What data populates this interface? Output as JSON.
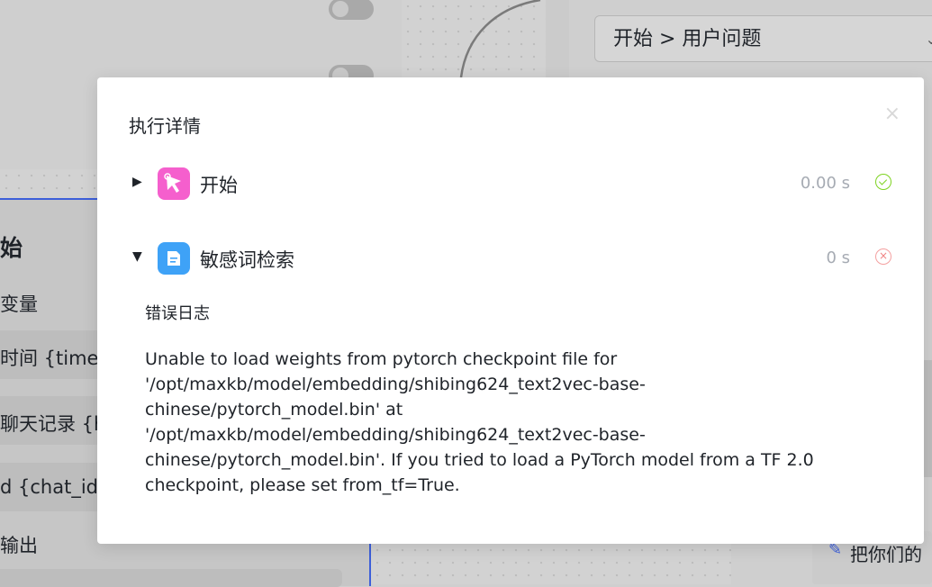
{
  "background": {
    "breadcrumb_select": {
      "value": "开始 > 用户问题"
    },
    "start_node": {
      "title": "始",
      "section_label": "变量",
      "fields": [
        "时间 {time}",
        "聊天记录 {h",
        "d {chat_id}"
      ],
      "output_label": "输出"
    },
    "right_card_text": "把你们的"
  },
  "modal": {
    "title": "执行详情",
    "close_symbol": "×",
    "steps": [
      {
        "name": "开始",
        "time": "0.00 s",
        "status": "success",
        "expanded": false,
        "icon": "cursor-icon",
        "icon_color": "#f55fcd"
      },
      {
        "name": "敏感词检索",
        "time": "0 s",
        "status": "error",
        "expanded": true,
        "icon": "document-icon",
        "icon_color": "#3ea2f7"
      }
    ],
    "error_log": {
      "label": "错误日志",
      "message": "Unable to load weights from pytorch checkpoint file for\n'/opt/maxkb/model/embedding/shibing624_text2vec-base-\nchinese/pytorch_model.bin' at\n'/opt/maxkb/model/embedding/shibing624_text2vec-base-\nchinese/pytorch_model.bin'. If you tried to load a PyTorch model from a TF 2.0\ncheckpoint, please set from_tf=True."
    }
  }
}
